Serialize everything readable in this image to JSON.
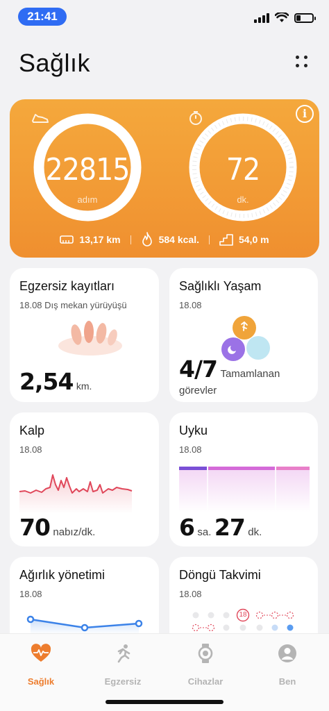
{
  "status": {
    "time": "21:41"
  },
  "header": {
    "title": "Sağlık"
  },
  "activity": {
    "steps": {
      "value": "22815",
      "unit": "adım",
      "icon": "shoe-icon",
      "progress": 1.0
    },
    "minutes": {
      "value": "72",
      "unit": "dk.",
      "icon": "stopwatch-icon",
      "progress": 1.0
    },
    "distance": "13,17 km",
    "calories": "584 kcal.",
    "floors": "54,0 m"
  },
  "cards": {
    "exercise": {
      "title": "Egzersiz kayıtları",
      "subtitle": "18.08 Dış mekan yürüyüşü",
      "value": "2,54",
      "unit": "km."
    },
    "healthy_living": {
      "title": "Sağlıklı Yaşam",
      "subtitle": "18.08",
      "value": "4/7",
      "caption_line1": "Tamamlanan",
      "caption_line2": "görevler"
    },
    "heart": {
      "title": "Kalp",
      "subtitle": "18.08",
      "value": "70",
      "unit": "nabız/dk."
    },
    "sleep": {
      "title": "Uyku",
      "subtitle": "18.08",
      "hours": "6",
      "hours_unit": "sa.",
      "minutes": "27",
      "minutes_unit": "dk."
    },
    "weight": {
      "title": "Ağırlık yönetimi",
      "subtitle": "18.08"
    },
    "cycle": {
      "title": "Döngü Takvimi",
      "subtitle": "18.08",
      "day_badge": "18"
    }
  },
  "nav": {
    "items": [
      {
        "label": "Sağlık",
        "icon": "heart-icon",
        "active": true
      },
      {
        "label": "Egzersiz",
        "icon": "running-icon",
        "active": false
      },
      {
        "label": "Cihazlar",
        "icon": "watch-icon",
        "active": false
      },
      {
        "label": "Ben",
        "icon": "profile-icon",
        "active": false
      }
    ]
  },
  "colors": {
    "accent": "#ed7d2e",
    "status_pill": "#2f6cf3",
    "heart_line": "#e0475a",
    "sleep_deep": "#7a4fd6",
    "sleep_light": "#d46ad8"
  }
}
